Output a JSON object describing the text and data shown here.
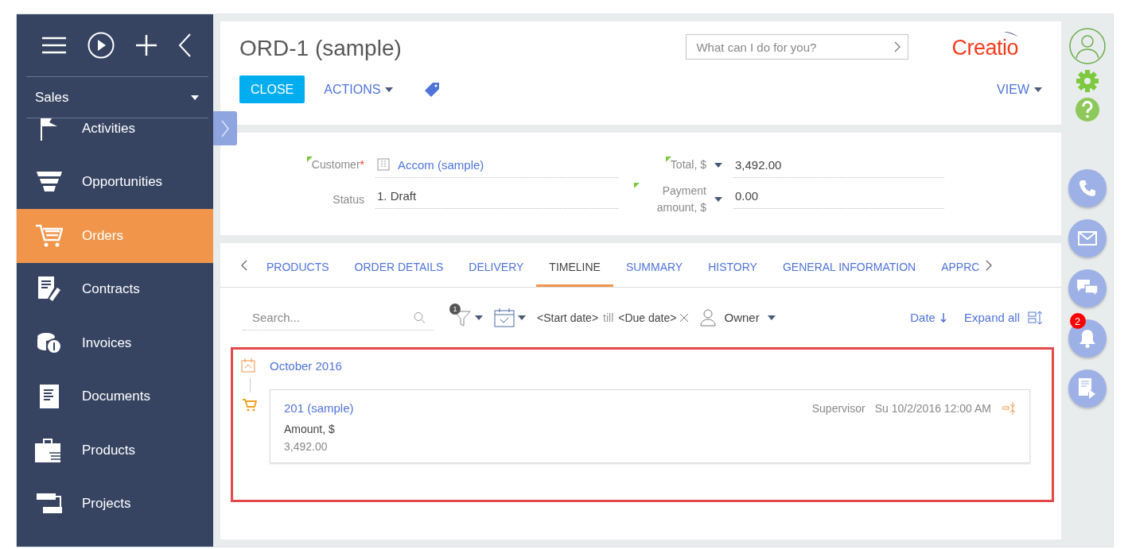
{
  "sidebar": {
    "section": "Sales",
    "items": [
      {
        "label": "Activities",
        "selected": false
      },
      {
        "label": "Opportunities",
        "selected": false
      },
      {
        "label": "Orders",
        "selected": true
      },
      {
        "label": "Contracts",
        "selected": false
      },
      {
        "label": "Invoices",
        "selected": false
      },
      {
        "label": "Documents",
        "selected": false
      },
      {
        "label": "Products",
        "selected": false
      },
      {
        "label": "Projects",
        "selected": false
      }
    ]
  },
  "header": {
    "title": "ORD-1 (sample)",
    "command_field": {
      "placeholder": "What can I do for you?"
    },
    "logo": "Creatio",
    "close": "CLOSE",
    "actions": "ACTIONS",
    "view": "VIEW"
  },
  "fields": [
    {
      "label": "Customer",
      "required_mark": "*",
      "marked": true,
      "kind": "lookup",
      "value": "Accom (sample)"
    },
    {
      "label": "Status",
      "marked": false,
      "kind": "text",
      "value": "1. Draft"
    },
    {
      "label": "Total, $",
      "marked": true,
      "kind": "amount",
      "value": "3,492.00"
    },
    {
      "label": "Payment amount, $",
      "marked": true,
      "kind": "amount",
      "value": "0.00"
    }
  ],
  "tabs": [
    {
      "label": "PRODUCTS",
      "selected": false
    },
    {
      "label": "ORDER DETAILS",
      "selected": false
    },
    {
      "label": "DELIVERY",
      "selected": false
    },
    {
      "label": "TIMELINE",
      "selected": true
    },
    {
      "label": "SUMMARY",
      "selected": false
    },
    {
      "label": "HISTORY",
      "selected": false
    },
    {
      "label": "GENERAL INFORMATION",
      "selected": false
    },
    {
      "label": "APPRC",
      "selected": false
    }
  ],
  "toolbar": {
    "search": {
      "placeholder": "Search..."
    },
    "filter_count": "1",
    "start_date": "<Start date>",
    "till": "till",
    "due_date": "<Due date>",
    "owner": "Owner",
    "sort": "Date",
    "expand": "Expand all"
  },
  "timeline": {
    "group": "October 2016",
    "entries": [
      {
        "title": "201 (sample)",
        "owner": "Supervisor",
        "date": "Su 10/2/2016 12:00 AM",
        "field_label": "Amount, $",
        "field_value": "3,492.00"
      }
    ]
  },
  "rail": {
    "notification_count": "2"
  }
}
